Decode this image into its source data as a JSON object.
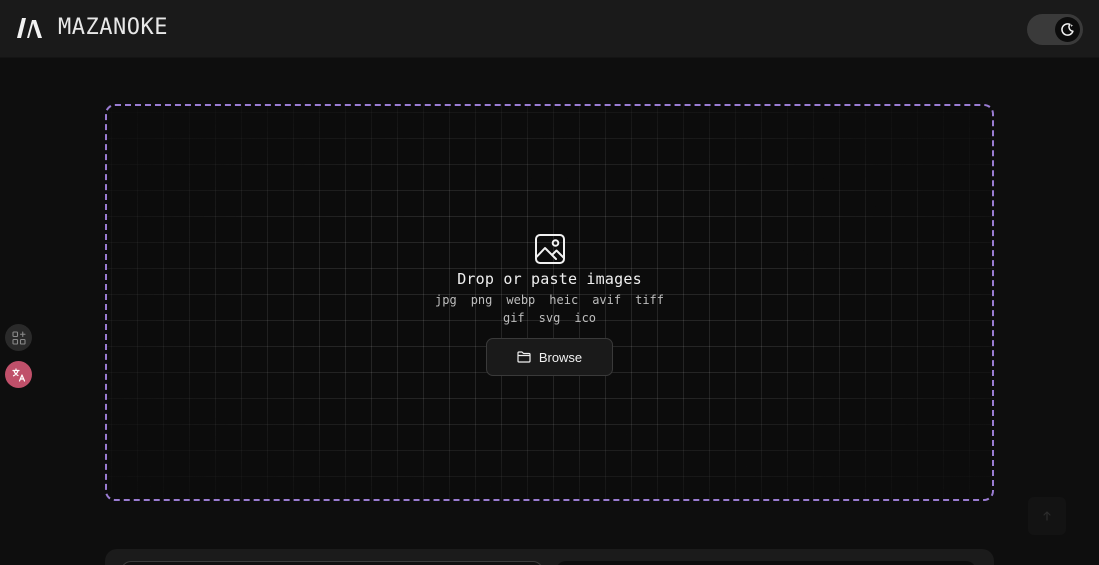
{
  "app": {
    "name": "MAZANOKE"
  },
  "header": {
    "theme_toggle_icon": "moon-icon"
  },
  "side_rail": {
    "buttons": [
      {
        "icon": "apps-add-icon"
      },
      {
        "icon": "translate-icon"
      }
    ]
  },
  "dropzone": {
    "icon": "image-icon",
    "title": "Drop or paste images",
    "formats": [
      "jpg",
      "png",
      "webp",
      "heic",
      "avif",
      "tiff",
      "gif",
      "svg",
      "ico"
    ],
    "browse_label": "Browse"
  },
  "colors": {
    "dropzone_border": "#9a7cd2",
    "translate_button": "#c0506a",
    "background": "#0e0e0e",
    "header": "#1a1a1a"
  }
}
